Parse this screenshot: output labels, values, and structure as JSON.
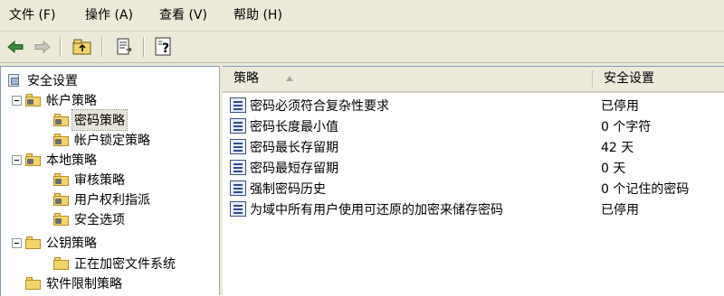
{
  "menubar": {
    "items": [
      {
        "label": "文件 (F)"
      },
      {
        "label": "操作 (A)"
      },
      {
        "label": "查看 (V)"
      },
      {
        "label": "帮助 (H)"
      }
    ]
  },
  "toolbar": {
    "buttons": [
      {
        "icon": "back-arrow-icon"
      },
      {
        "icon": "forward-arrow-icon"
      },
      {
        "icon": "up-folder-icon"
      },
      {
        "icon": "export-list-icon"
      },
      {
        "icon": "help-icon"
      }
    ]
  },
  "tree": {
    "items": [
      {
        "label": "安全设置"
      },
      {
        "label": "帐户策略"
      },
      {
        "label": "密码策略"
      },
      {
        "label": "帐户锁定策略"
      },
      {
        "label": "本地策略"
      },
      {
        "label": "审核策略"
      },
      {
        "label": "用户权利指派"
      },
      {
        "label": "安全选项"
      },
      {
        "label": "公钥策略"
      },
      {
        "label": "正在加密文件系统"
      },
      {
        "label": "软件限制策略"
      }
    ]
  },
  "list": {
    "columns": {
      "policy": "策略",
      "setting": "安全设置"
    },
    "rows": [
      {
        "policy": "密码必须符合复杂性要求",
        "setting": "已停用"
      },
      {
        "policy": "密码长度最小值",
        "setting": "0 个字符"
      },
      {
        "policy": "密码最长存留期",
        "setting": "42 天"
      },
      {
        "policy": "密码最短存留期",
        "setting": "0 天"
      },
      {
        "policy": "强制密码历史",
        "setting": "0 个记住的密码"
      },
      {
        "policy": "为域中所有用户使用可还原的加密来储存密码",
        "setting": "已停用"
      }
    ]
  }
}
